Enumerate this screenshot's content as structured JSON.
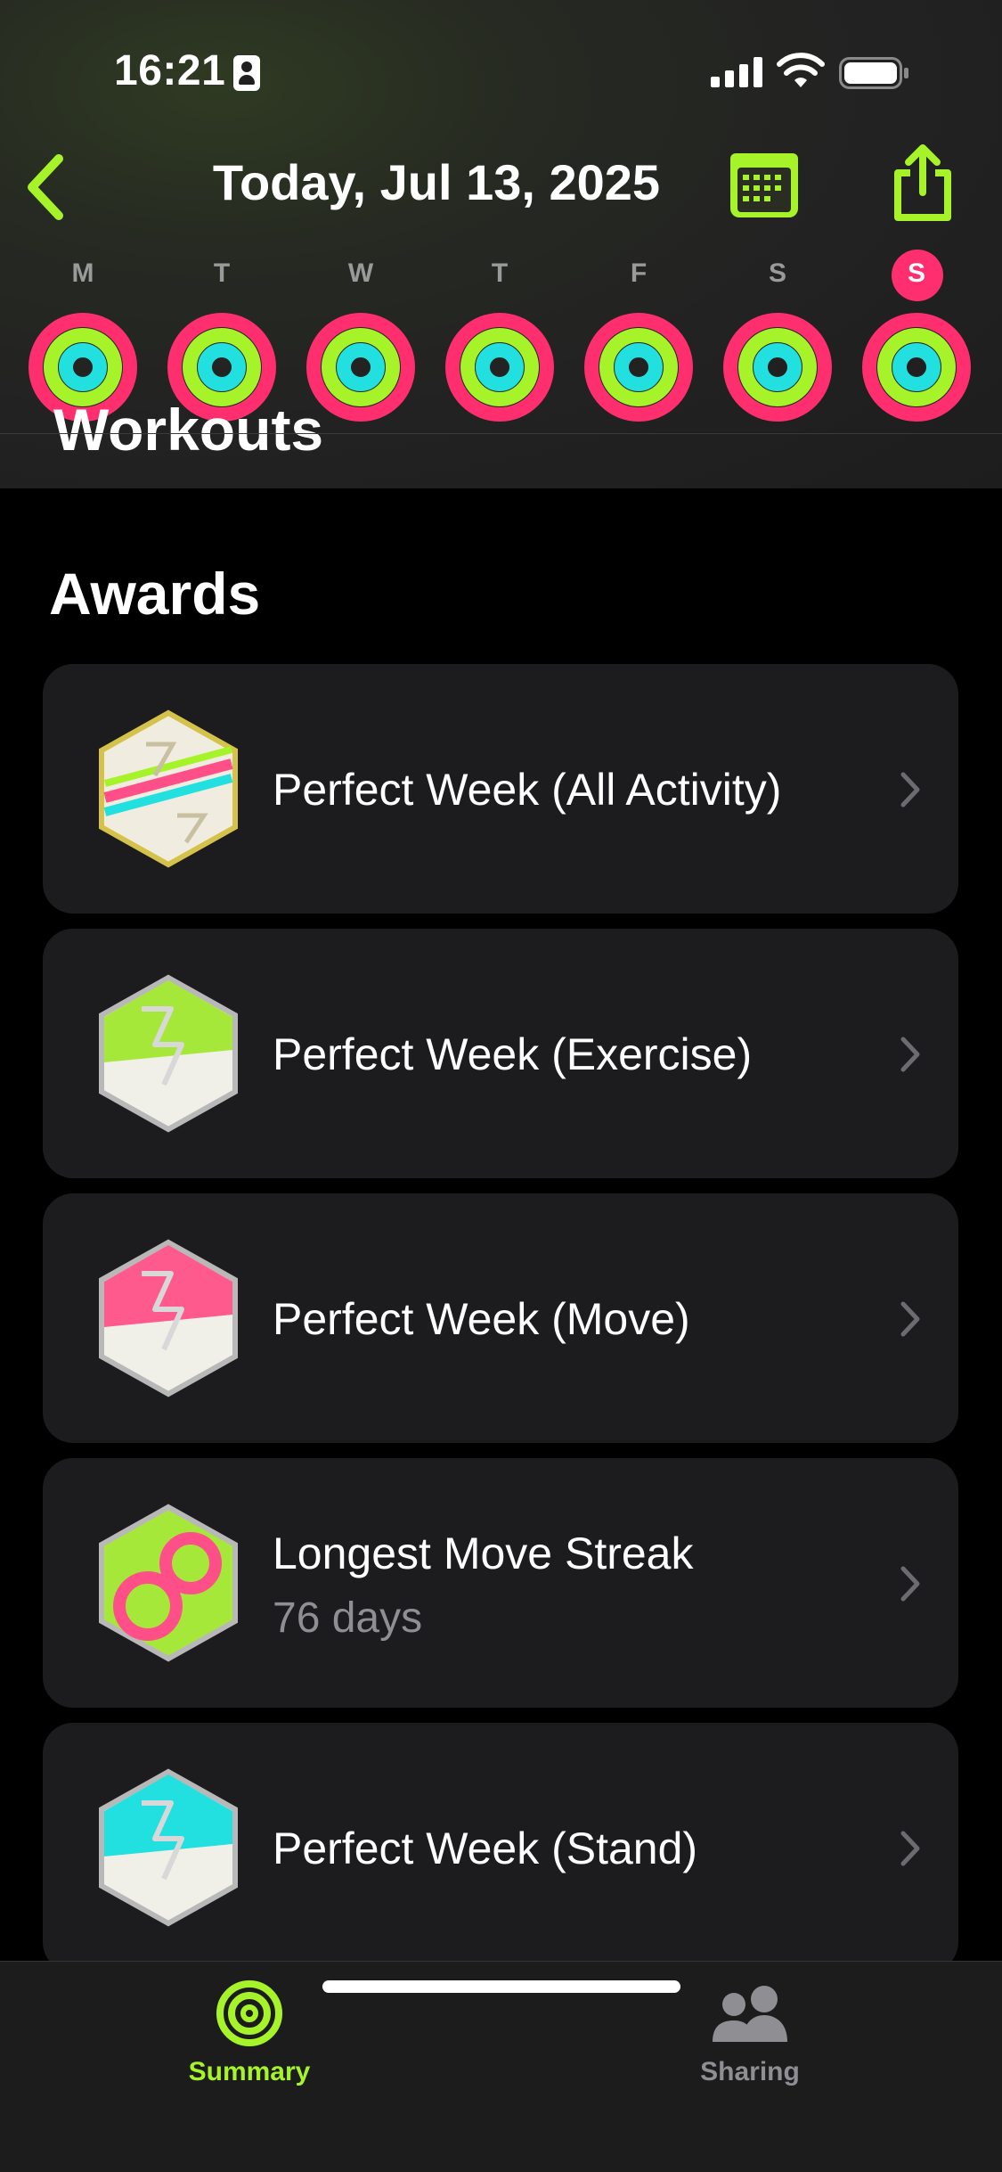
{
  "status_bar": {
    "time": "16:21"
  },
  "nav": {
    "title": "Today, Jul 13, 2025"
  },
  "week": {
    "days": [
      {
        "letter": "M"
      },
      {
        "letter": "T"
      },
      {
        "letter": "W"
      },
      {
        "letter": "T"
      },
      {
        "letter": "F"
      },
      {
        "letter": "S"
      },
      {
        "letter": "S"
      }
    ]
  },
  "sections": {
    "workouts_title": "Workouts",
    "awards_title": "Awards"
  },
  "awards": [
    {
      "title": "Perfect Week (All Activity)",
      "subtitle": "",
      "badge": "perfect-week-all-activity-badge-icon"
    },
    {
      "title": "Perfect Week (Exercise)",
      "subtitle": "",
      "badge": "perfect-week-exercise-badge-icon"
    },
    {
      "title": "Perfect Week (Move)",
      "subtitle": "",
      "badge": "perfect-week-move-badge-icon"
    },
    {
      "title": "Longest Move Streak",
      "subtitle": "76 days",
      "badge": "longest-move-streak-badge-icon"
    },
    {
      "title": "Perfect Week (Stand)",
      "subtitle": "",
      "badge": "perfect-week-stand-badge-icon"
    }
  ],
  "tabs": [
    {
      "label": "Summary",
      "icon": "activity-rings-icon",
      "selected": true
    },
    {
      "label": "Sharing",
      "icon": "people-icon",
      "selected": false
    }
  ],
  "colors": {
    "accent": "#a6f32a",
    "move": "#ff2e6e",
    "exercise": "#a6f32a",
    "stand": "#22e0df",
    "card": "#1c1c1e",
    "secondary_text": "#8e8e93"
  }
}
